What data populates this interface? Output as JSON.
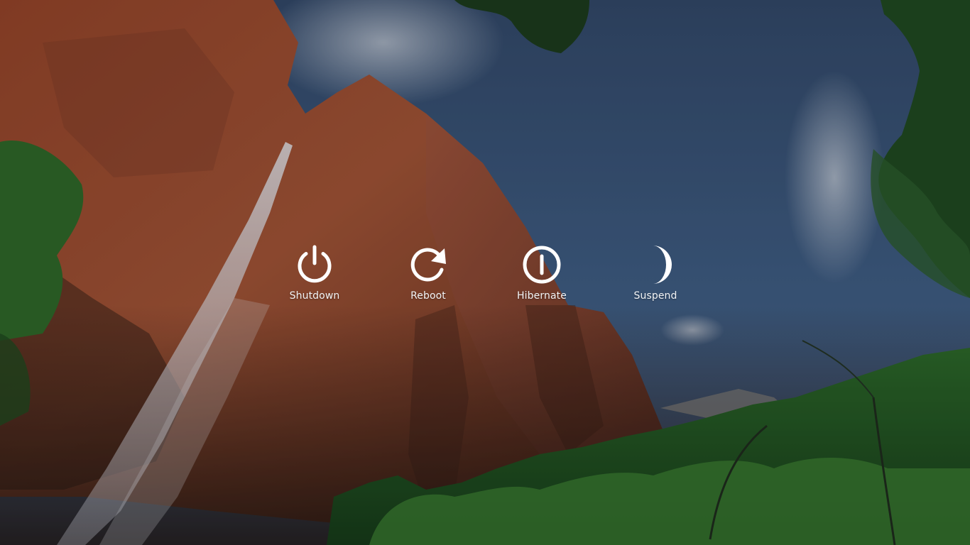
{
  "power_menu": {
    "options": [
      {
        "label": "Shutdown",
        "icon": "power-icon"
      },
      {
        "label": "Reboot",
        "icon": "reboot-icon"
      },
      {
        "label": "Hibernate",
        "icon": "hibernate-icon"
      },
      {
        "label": "Suspend",
        "icon": "moon-icon"
      }
    ]
  },
  "wallpaper": {
    "subject": "canyon cliff with waterfall",
    "colors": {
      "sky": "#3c5a80",
      "rock": "#a0482c",
      "foliage": "#2f6b27",
      "icon": "#ffffff"
    }
  }
}
